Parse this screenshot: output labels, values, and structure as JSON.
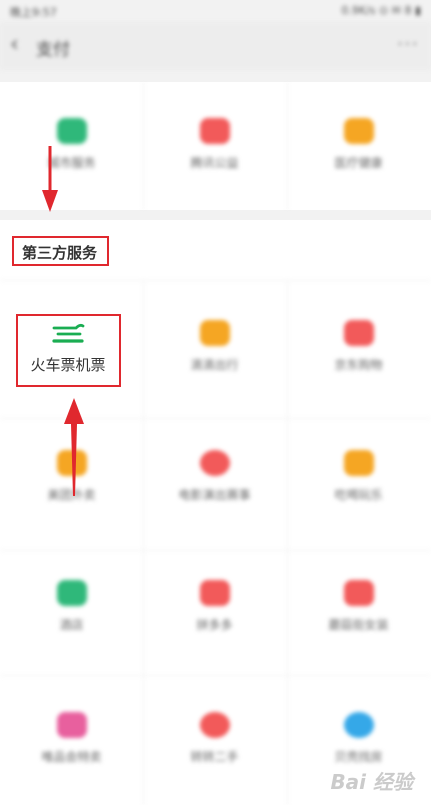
{
  "status_bar": {
    "left": "晚上9:57",
    "right": "0.9K/s ⊙ ✉ 8 ▮"
  },
  "header": {
    "back_icon": "chevron-left-icon",
    "title": "支付",
    "more": "···"
  },
  "top_services": [
    {
      "label": "城市服务",
      "color": "#2fb87a",
      "icon": "city-service-icon"
    },
    {
      "label": "腾讯公益",
      "color": "#f25a5a",
      "icon": "charity-heart-icon"
    },
    {
      "label": "医疗健康",
      "color": "#f5a623",
      "icon": "medical-icon"
    }
  ],
  "third_party_section": {
    "title": "第三方服务"
  },
  "highlighted_service": {
    "label": "火车票机票",
    "icon": "train-ticket-icon",
    "color": "#1aad52"
  },
  "third_party_services": [
    {
      "label": "滴滴出行",
      "color": "#f5a623",
      "icon": "didi-icon"
    },
    {
      "label": "京东购物",
      "color": "#f25a5a",
      "icon": "jd-shopping-icon"
    },
    {
      "label": "美团外卖",
      "color": "#f5a623",
      "icon": "meituan-takeout-icon"
    },
    {
      "label": "电影演出赛事",
      "color": "#f25a5a",
      "icon": "movie-ticket-icon"
    },
    {
      "label": "吃喝玩乐",
      "color": "#f5a623",
      "icon": "food-fun-icon"
    },
    {
      "label": "酒店",
      "color": "#2fb87a",
      "icon": "hotel-icon"
    },
    {
      "label": "拼多多",
      "color": "#f25a5a",
      "icon": "pinduoduo-icon"
    },
    {
      "label": "蘑菇街女装",
      "color": "#f25a5a",
      "icon": "mogujie-icon"
    },
    {
      "label": "唯品会特卖",
      "color": "#e8609e",
      "icon": "vipshop-icon"
    },
    {
      "label": "转转二手",
      "color": "#f25a5a",
      "icon": "zhuanzhuan-icon"
    },
    {
      "label": "贝壳找房",
      "color": "#35a8e8",
      "icon": "beike-house-icon"
    }
  ],
  "annotations": {
    "arrow_color": "#e0282e"
  },
  "watermark": "Bai 经验"
}
